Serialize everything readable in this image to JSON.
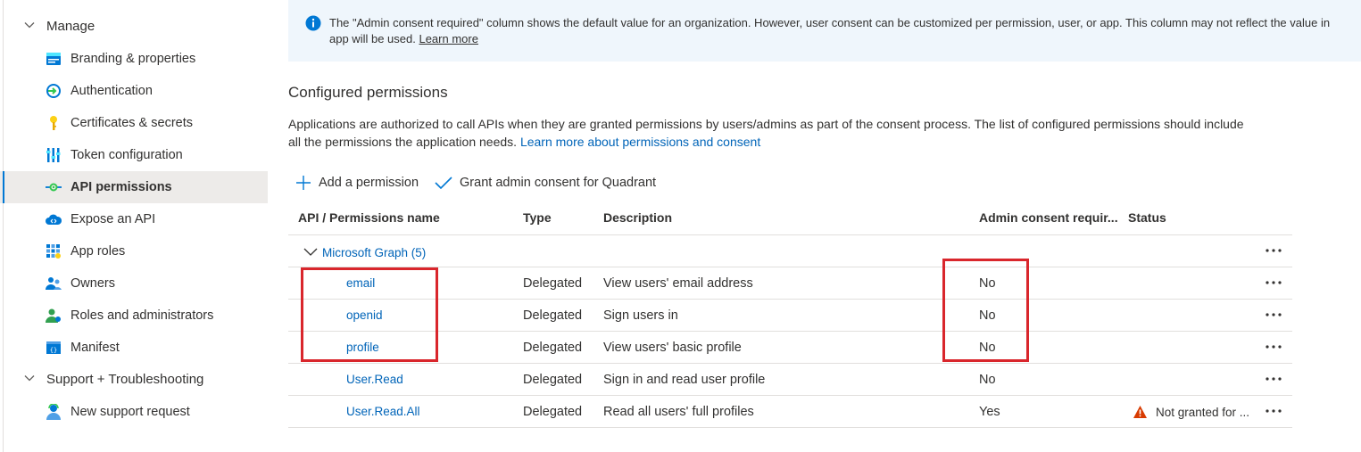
{
  "sidebar": {
    "manage_label": "Manage",
    "items": [
      {
        "label": "Branding & properties",
        "icon": "branding-icon"
      },
      {
        "label": "Authentication",
        "icon": "authentication-icon"
      },
      {
        "label": "Certificates & secrets",
        "icon": "key-icon"
      },
      {
        "label": "Token configuration",
        "icon": "token-icon"
      },
      {
        "label": "API permissions",
        "icon": "api-permissions-icon",
        "active": true
      },
      {
        "label": "Expose an API",
        "icon": "cloud-icon"
      },
      {
        "label": "App roles",
        "icon": "grid-icon"
      },
      {
        "label": "Owners",
        "icon": "owners-icon"
      },
      {
        "label": "Roles and administrators",
        "icon": "roles-icon"
      },
      {
        "label": "Manifest",
        "icon": "manifest-icon"
      }
    ],
    "support_label": "Support + Troubleshooting",
    "support_items": [
      {
        "label": "New support request",
        "icon": "support-person-icon"
      }
    ]
  },
  "info": {
    "text_line1": "The \"Admin consent required\" column shows the default value for an organization. However, user consent can be customized per permission, user, or app. This column may not reflect the value in",
    "text_line2": "app will be used.",
    "learn_more": "Learn more"
  },
  "configured": {
    "title": "Configured permissions",
    "desc_line1": "Applications are authorized to call APIs when they are granted permissions by users/admins as part of the consent process. The list of configured permissions should include",
    "desc_line2": "all the permissions the application needs.",
    "desc_link": "Learn more about permissions and consent"
  },
  "toolbar": {
    "add_label": "Add a permission",
    "grant_label": "Grant admin consent for Quadrant"
  },
  "table": {
    "headers": {
      "name": "API / Permissions name",
      "type": "Type",
      "description": "Description",
      "admin": "Admin consent requir...",
      "status": "Status"
    },
    "group": "Microsoft Graph (5)",
    "rows": [
      {
        "name": "email",
        "type": "Delegated",
        "description": "View users' email address",
        "admin": "No",
        "status": ""
      },
      {
        "name": "openid",
        "type": "Delegated",
        "description": "Sign users in",
        "admin": "No",
        "status": ""
      },
      {
        "name": "profile",
        "type": "Delegated",
        "description": "View users' basic profile",
        "admin": "No",
        "status": ""
      },
      {
        "name": "User.Read",
        "type": "Delegated",
        "description": "Sign in and read user profile",
        "admin": "No",
        "status": ""
      },
      {
        "name": "User.Read.All",
        "type": "Delegated",
        "description": "Read all users' full profiles",
        "admin": "Yes",
        "status": "Not granted for ..."
      }
    ]
  },
  "colors": {
    "accent": "#0078d4",
    "link": "#0064b8",
    "highlight": "#d9262c",
    "warning": "#d83b01"
  }
}
